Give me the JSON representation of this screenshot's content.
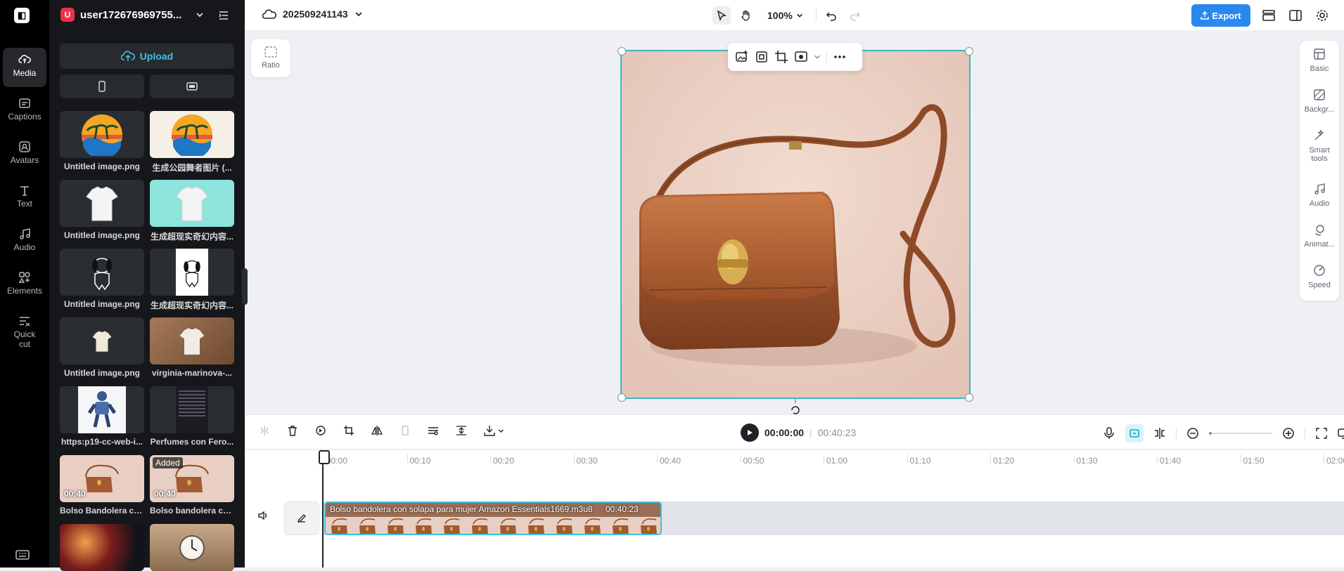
{
  "rail": {
    "items": [
      {
        "label": "Media",
        "icon": "cloud-media-icon",
        "active": true
      },
      {
        "label": "Captions",
        "icon": "captions-icon"
      },
      {
        "label": "Avatars",
        "icon": "avatar-icon"
      },
      {
        "label": "Text",
        "icon": "text-icon"
      },
      {
        "label": "Audio",
        "icon": "music-note-icon"
      },
      {
        "label": "Elements",
        "icon": "elements-icon"
      },
      {
        "label": "Quick cut",
        "label_lines": [
          "Quick",
          "cut"
        ],
        "icon": "quick-cut-icon"
      }
    ]
  },
  "account": {
    "initial": "U",
    "name": "user172676969755...",
    "avatar_color": "#e8334a"
  },
  "media": {
    "upload_label": "Upload",
    "accent": "#3fc1e1",
    "items": [
      {
        "caption": "Untitled image.png",
        "kind": "sunset-palm"
      },
      {
        "caption": "生成公园舞者图片 (...",
        "kind": "sunset-palm-light"
      },
      {
        "caption": "Untitled image.png",
        "kind": "tshirt-dark"
      },
      {
        "caption": "生成超现实奇幻内容...",
        "kind": "tshirt-teal"
      },
      {
        "caption": "Untitled image.png",
        "kind": "dog-dark"
      },
      {
        "caption": "生成超现实奇幻内容...",
        "kind": "dog-light"
      },
      {
        "caption": "Untitled image.png",
        "kind": "tshirt-small"
      },
      {
        "caption": "virginia-marinova-...",
        "kind": "tshirt-wood"
      },
      {
        "caption": "https:p19-cc-web-i...",
        "kind": "robot"
      },
      {
        "caption": "Perfumes con Fero...",
        "kind": "document"
      },
      {
        "caption": "Bolso Bandolera co...",
        "kind": "bag",
        "duration": "00:40"
      },
      {
        "caption": "Bolso bandolera co...",
        "kind": "bag",
        "duration": "00:40",
        "badge": "Added"
      },
      {
        "caption": "",
        "kind": "city-lights"
      },
      {
        "caption": "",
        "kind": "watch"
      }
    ]
  },
  "topbar": {
    "project_name": "202509241143",
    "zoom": "100%",
    "export_label": "Export",
    "export_color": "#2b88ef"
  },
  "canvas": {
    "ratio_label": "Ratio",
    "selection_color": "#3fb7c1"
  },
  "right_panel": {
    "items": [
      {
        "label": "Basic",
        "icon": "basic-icon"
      },
      {
        "label": "Backgr...",
        "icon": "background-icon"
      },
      {
        "label": "Smart tools",
        "label_lines": [
          "Smart",
          "tools"
        ],
        "icon": "magic-wand-icon"
      },
      {
        "label": "Audio",
        "icon": "music-note-icon"
      },
      {
        "label": "Animat...",
        "icon": "animation-icon"
      },
      {
        "label": "Speed",
        "icon": "speed-icon"
      }
    ]
  },
  "playback": {
    "current_time": "00:00:00",
    "separator": "|",
    "total_time": "00:40:23"
  },
  "timeline": {
    "ticks": [
      "00:00",
      "00:10",
      "00:20",
      "00:30",
      "00:40",
      "00:50",
      "01:00",
      "01:10",
      "01:20",
      "01:30",
      "01:40",
      "01:50",
      "02:00"
    ],
    "clip": {
      "title": "Bolso bandolera con solapa para mujer Amazon Essentials1669.m3u8",
      "duration": "00:40:23"
    }
  }
}
